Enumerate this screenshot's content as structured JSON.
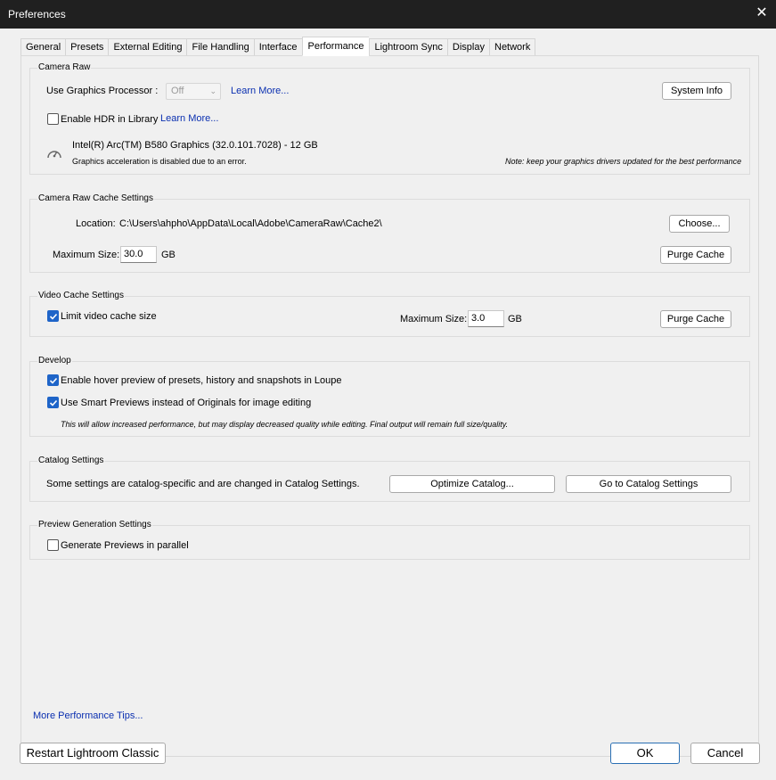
{
  "window": {
    "title": "Preferences",
    "close_glyph": "✕"
  },
  "tabs": [
    {
      "label": "General"
    },
    {
      "label": "Presets"
    },
    {
      "label": "External Editing"
    },
    {
      "label": "File Handling"
    },
    {
      "label": "Interface"
    },
    {
      "label": "Performance",
      "active": true
    },
    {
      "label": "Lightroom Sync"
    },
    {
      "label": "Display"
    },
    {
      "label": "Network"
    }
  ],
  "camera_raw": {
    "group_label": "Camera Raw",
    "gpu_label": "Use Graphics Processor :",
    "gpu_value": "Off",
    "learn_more_1": "Learn More...",
    "system_info_button": "System Info",
    "hdr_label": "Enable HDR in Library",
    "hdr_checked": false,
    "learn_more_2": "Learn More...",
    "gpu_name": "Intel(R) Arc(TM) B580 Graphics (32.0.101.7028) - 12 GB",
    "gpu_status": "Graphics acceleration is disabled due to an error.",
    "driver_note": "Note: keep your graphics drivers updated for the best performance",
    "gauge_icon": "speedometer-icon"
  },
  "cache": {
    "group_label": "Camera Raw Cache Settings",
    "location_label": "Location:",
    "location_value": "C:\\Users\\ahpho\\AppData\\Local\\Adobe\\CameraRaw\\Cache2\\",
    "choose_button": "Choose...",
    "max_size_label": "Maximum Size:",
    "max_size_value": "30.0",
    "unit": "GB",
    "purge_button": "Purge Cache"
  },
  "video_cache": {
    "group_label": "Video Cache Settings",
    "limit_label": "Limit video cache size",
    "limit_checked": true,
    "max_size_label": "Maximum Size:",
    "max_size_value": "3.0",
    "unit": "GB",
    "purge_button": "Purge Cache"
  },
  "develop": {
    "group_label": "Develop",
    "hover_label": "Enable hover preview of presets, history and snapshots in Loupe",
    "hover_checked": true,
    "smart_label": "Use Smart Previews instead of Originals for image editing",
    "smart_checked": true,
    "note": "This will allow increased performance, but may display decreased quality while editing. Final output will remain full size/quality."
  },
  "catalog": {
    "group_label": "Catalog Settings",
    "text": "Some settings are catalog-specific and are changed in Catalog Settings.",
    "optimize_button": "Optimize Catalog...",
    "goto_button": "Go to Catalog Settings"
  },
  "preview": {
    "group_label": "Preview Generation Settings",
    "parallel_label": "Generate Previews in parallel",
    "parallel_checked": false
  },
  "footer": {
    "tips_link": "More Performance Tips...",
    "restart_button": "Restart Lightroom Classic",
    "ok_button": "OK",
    "cancel_button": "Cancel"
  },
  "colors": {
    "link": "#0a2fb0",
    "checkbox_checked": "#1e64c8",
    "titlebar": "#202020",
    "dialog_bg": "#f0f0f0"
  }
}
